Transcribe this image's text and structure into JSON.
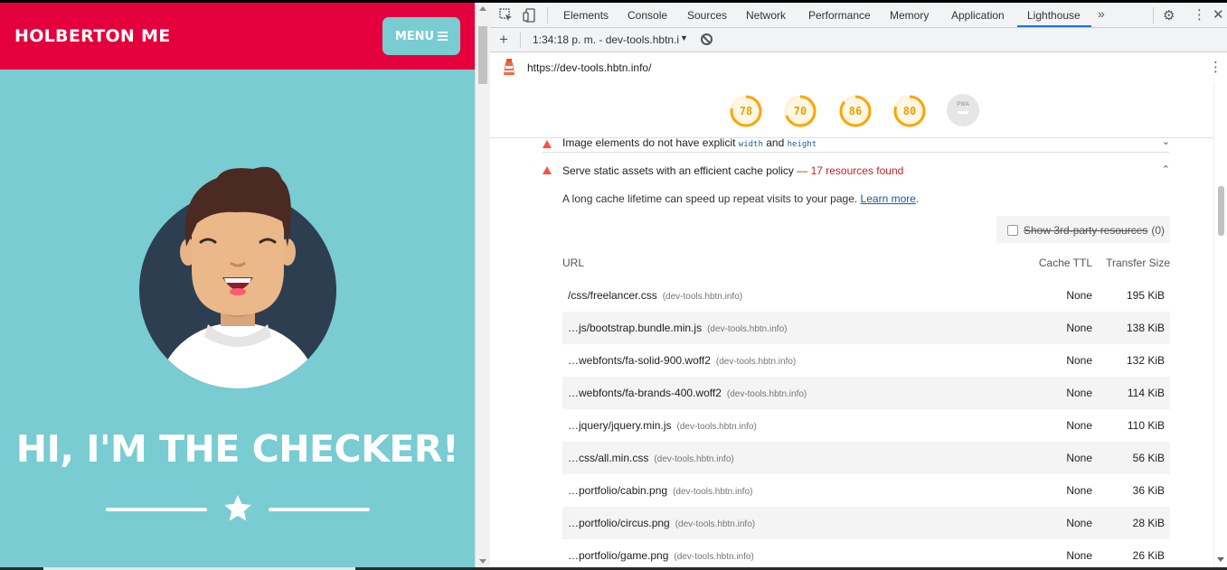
{
  "site": {
    "brand": "HOLBERTON ME",
    "menu_label": "MENU",
    "hero_title": "HI, I'M THE CHECKER!",
    "colors": {
      "nav": "#e4003c",
      "background": "#78ccd2",
      "accent": "#ffffff"
    }
  },
  "devtools": {
    "tabs": [
      "Elements",
      "Console",
      "Sources",
      "Network",
      "Performance",
      "Memory",
      "Application",
      "Lighthouse"
    ],
    "active_tab": "Lighthouse",
    "report_selector": "1:34:18 p. m. - dev-tools.hbtn.i",
    "url": "https://dev-tools.hbtn.info/",
    "scores": [
      {
        "value": "78",
        "fraction": 0.78
      },
      {
        "value": "70",
        "fraction": 0.7
      },
      {
        "value": "86",
        "fraction": 0.86
      },
      {
        "value": "80",
        "fraction": 0.8
      }
    ],
    "pwa_badge": "PWA",
    "audits": {
      "image_elements": {
        "title_pre": "Image elements do not have explicit",
        "code_width": "width",
        "title_mid": "and",
        "code_height": "height"
      },
      "cache_policy": {
        "title": "Serve static assets with an efficient cache policy",
        "display_value": "— 17 resources found",
        "description": "A long cache lifetime can speed up repeat visits to your page.",
        "learn_more": "Learn more",
        "third_party_label": "Show 3rd-party resources",
        "third_party_count": "(0)",
        "columns": {
          "url": "URL",
          "ttl": "Cache TTL",
          "size": "Transfer Size"
        },
        "rows": [
          {
            "url": "/css/freelancer.css",
            "host": "(dev-tools.hbtn.info)",
            "ttl": "None",
            "size": "195 KiB"
          },
          {
            "url": "…js/bootstrap.bundle.min.js",
            "host": "(dev-tools.hbtn.info)",
            "ttl": "None",
            "size": "138 KiB"
          },
          {
            "url": "…webfonts/fa-solid-900.woff2",
            "host": "(dev-tools.hbtn.info)",
            "ttl": "None",
            "size": "132 KiB"
          },
          {
            "url": "…webfonts/fa-brands-400.woff2",
            "host": "(dev-tools.hbtn.info)",
            "ttl": "None",
            "size": "114 KiB"
          },
          {
            "url": "…jquery/jquery.min.js",
            "host": "(dev-tools.hbtn.info)",
            "ttl": "None",
            "size": "110 KiB"
          },
          {
            "url": "…css/all.min.css",
            "host": "(dev-tools.hbtn.info)",
            "ttl": "None",
            "size": "56 KiB"
          },
          {
            "url": "…portfolio/cabin.png",
            "host": "(dev-tools.hbtn.info)",
            "ttl": "None",
            "size": "36 KiB"
          },
          {
            "url": "…portfolio/circus.png",
            "host": "(dev-tools.hbtn.info)",
            "ttl": "None",
            "size": "28 KiB"
          },
          {
            "url": "…portfolio/game.png",
            "host": "(dev-tools.hbtn.info)",
            "ttl": "None",
            "size": "26 KiB"
          }
        ]
      }
    },
    "colors": {
      "score_average": "#ffa400",
      "fail": "#ff4e42",
      "link": "#1a5aa0",
      "active_tab": "#1a73e8"
    }
  }
}
